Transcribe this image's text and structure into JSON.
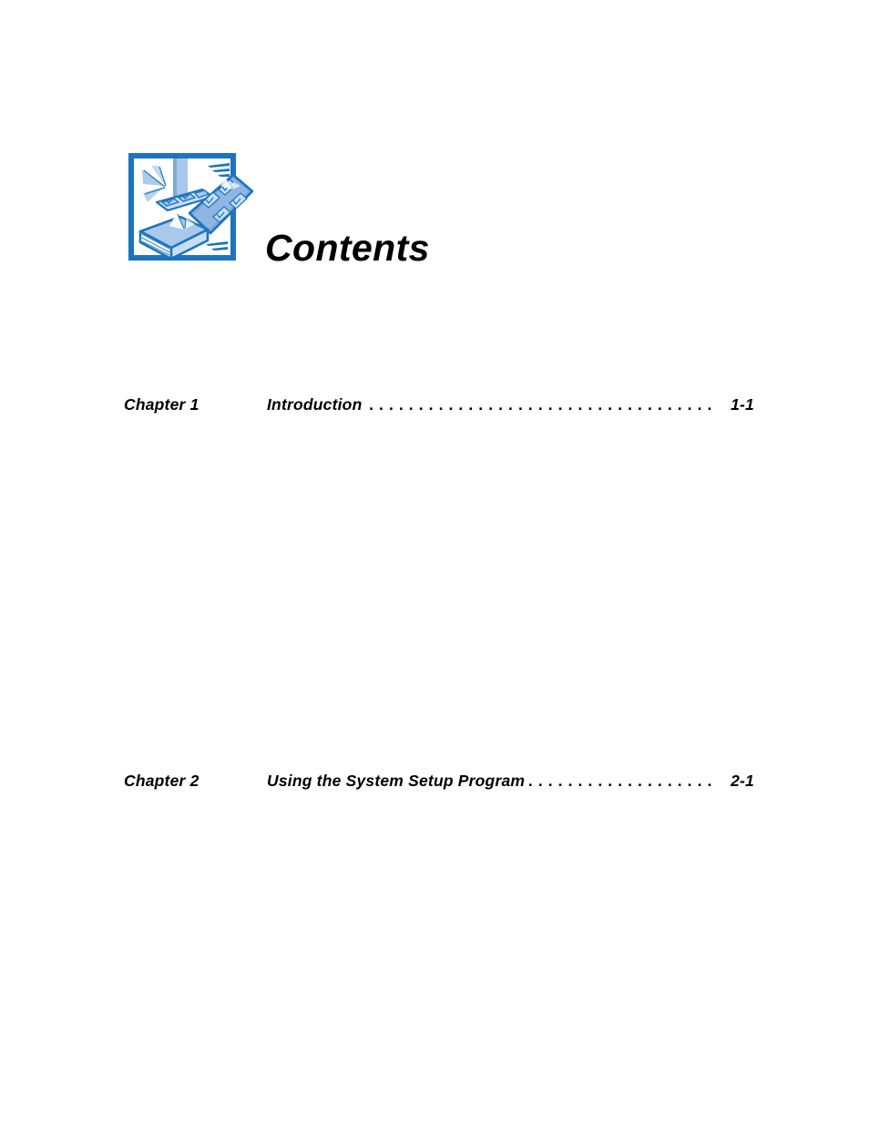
{
  "page": {
    "title": "Contents",
    "background_color": "#ffffff",
    "text_color": "#000000"
  },
  "icon": {
    "name": "contents-book-icon",
    "frame_color": "#1C75BC",
    "fill_light": "#A8C8EC",
    "fill_mid": "#7FA9DC",
    "fill_pale": "#D6E5F7",
    "white": "#ffffff"
  },
  "toc": {
    "leader_char": ".",
    "entries": [
      {
        "chapter_label": "Chapter 1",
        "title": "Introduction",
        "page": "1-1"
      },
      {
        "chapter_label": "Chapter 2",
        "title": "Using the System Setup Program",
        "page": "2-1"
      }
    ]
  }
}
